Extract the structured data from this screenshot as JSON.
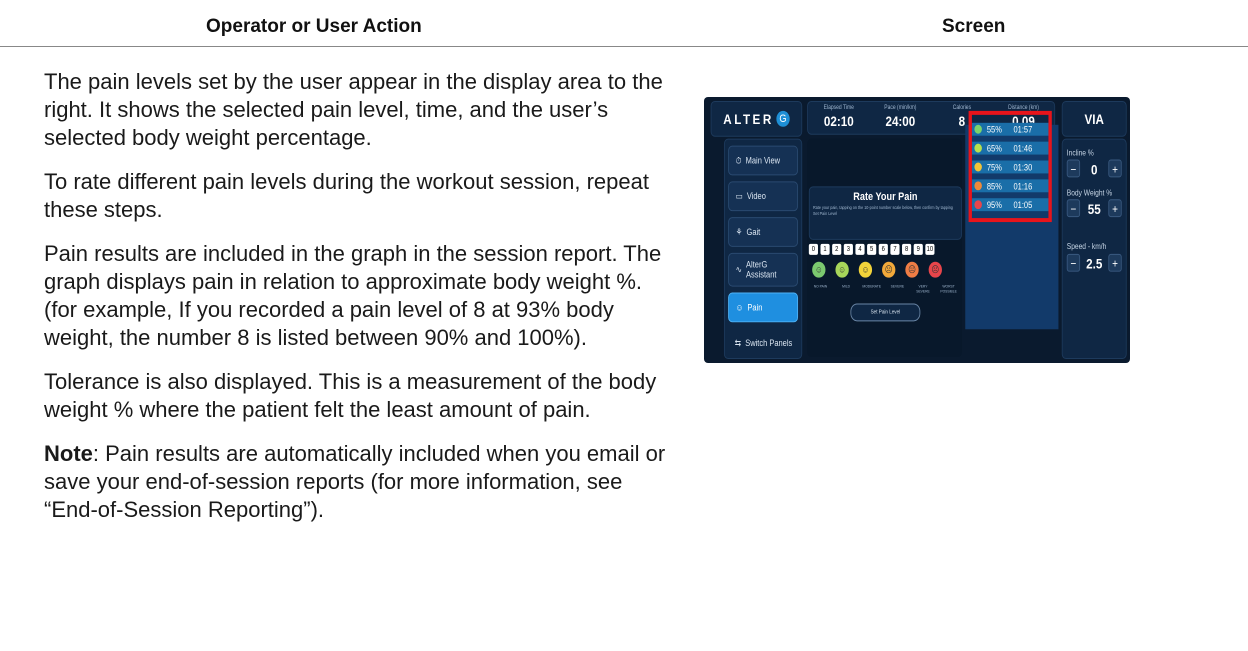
{
  "headers": {
    "action": "Operator or User Action",
    "screen": "Screen"
  },
  "paragraphs": [
    "The pain levels set by the user appear in the display area to the right. It shows the selected pain level, time, and the user’s selected body weight percentage.",
    "To rate different pain levels during the workout session, repeat these steps.",
    "Pain results are included in the graph in the session report. The graph displays pain in relation to approximate body weight %. (for example, If you recorded a pain level of 8 at 93% body weight, the number 8 is listed between 90% and 100%).",
    "Tolerance is also displayed. This is a measurement of the body weight % where the patient felt the least amount of pain."
  ],
  "note": {
    "label": "Note",
    "text": ": Pain results are automatically included when you email or save your end-of-session reports (for more information, see “End-of-Session Reporting”)."
  },
  "screen": {
    "logo": "ALTER",
    "logo_g": "G",
    "stats": [
      {
        "label": "Elapsed Time",
        "value": "02:10"
      },
      {
        "label": "Pace (min/km)",
        "value": "24:00"
      },
      {
        "label": "Calories",
        "value": "8"
      },
      {
        "label": "Distance (km)",
        "value": "0.09"
      }
    ],
    "via": "VIA",
    "nav": [
      {
        "label": "Main View",
        "icon": "timer-icon"
      },
      {
        "label": "Video",
        "icon": "video-icon"
      },
      {
        "label": "Gait",
        "icon": "gait-icon"
      },
      {
        "label": "AlterG Assistant",
        "icon": "pulse-icon"
      },
      {
        "label": "Pain",
        "icon": "pain-icon"
      },
      {
        "label": "Switch Panels",
        "icon": "switch-icon"
      }
    ],
    "rate": {
      "title": "Rate Your Pain",
      "subtitle": "Rate your pain, tapping on the 10-point number scale below, then confirm by tapping Set Pain Level",
      "numbers": [
        "0",
        "1",
        "2",
        "3",
        "4",
        "5",
        "6",
        "7",
        "8",
        "9",
        "10"
      ],
      "face_labels": [
        "NO PAIN",
        "MILD",
        "MODERATE",
        "SEVERE",
        "VERY SEVERE",
        "WORST POSSIBLE"
      ],
      "face_colors": [
        "#7bc96f",
        "#a7d65a",
        "#f2d33a",
        "#f2a93a",
        "#ef7d45",
        "#e8454b"
      ],
      "button": "Set Pain Level"
    },
    "results": [
      {
        "pct": "55%",
        "time": "01:57",
        "color": "#7bd36b"
      },
      {
        "pct": "65%",
        "time": "01:46",
        "color": "#b8e04e"
      },
      {
        "pct": "75%",
        "time": "01:30",
        "color": "#f2c43a"
      },
      {
        "pct": "85%",
        "time": "01:16",
        "color": "#ef8a3a"
      },
      {
        "pct": "95%",
        "time": "01:05",
        "color": "#e8454b"
      }
    ],
    "controls": {
      "incline_label": "Incline %",
      "incline_value": "0",
      "bw_label": "Body Weight %",
      "bw_value": "55",
      "speed_label": "Speed - km/h",
      "speed_value": "2.5",
      "minus": "−",
      "plus": "+"
    }
  }
}
